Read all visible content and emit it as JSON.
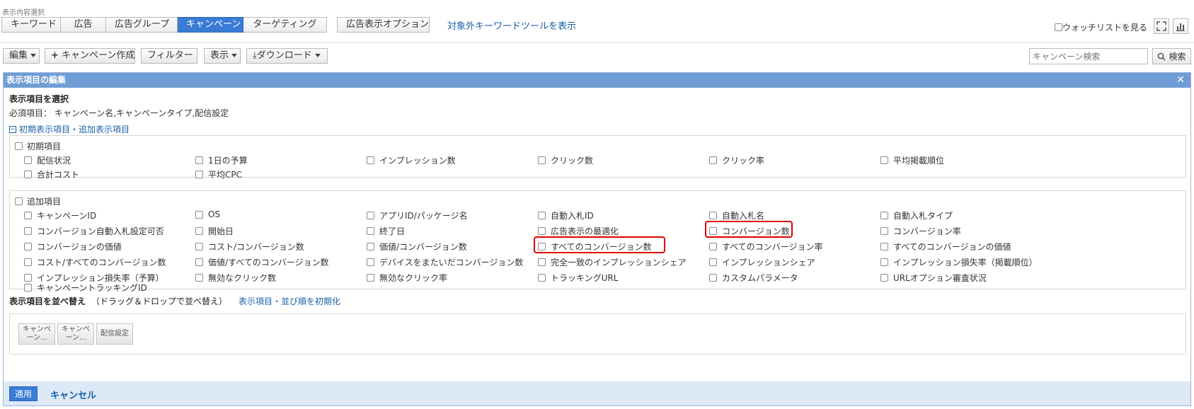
{
  "header": {
    "select_caption": "表示内容選択",
    "tabs": [
      "キーワード",
      "広告",
      "広告グループ",
      "キャンペーン",
      "ターゲティング"
    ],
    "active_tab": "キャンペーン",
    "option_tab": "広告表示オプション",
    "kw_tool_link": "対象外キーワードツールを表示",
    "watchlist_label": "ウォッチリストを見る"
  },
  "toolbar": {
    "edit": "編集",
    "create": "キャンペーン作成",
    "filter": "フィルター",
    "display": "表示",
    "download": "ダウンロード",
    "search_placeholder": "キャンペーン検索",
    "search_button": "検索"
  },
  "panel": {
    "title": "表示項目の編集",
    "select_title": "表示項目を選択",
    "required": "必須項目： キャンペーン名,キャンペーンタイプ,配信設定",
    "toggle_link": "初期表示項目・追加表示項目",
    "initial": {
      "title": "初期項目",
      "items": [
        "配信状況",
        "1日の予算",
        "インプレッション数",
        "クリック数",
        "クリック率",
        "平均掲載順位",
        "合計コスト",
        "平均CPC"
      ]
    },
    "additional": {
      "title": "追加項目",
      "items": [
        "キャンペーンID",
        "OS",
        "アプリID/パッケージ名",
        "自動入札ID",
        "自動入札名",
        "自動入札タイプ",
        "コンバージョン自動入札設定可否",
        "開始日",
        "終了日",
        "広告表示の最適化",
        "コンバージョン数",
        "コンバージョン率",
        "コンバージョンの価値",
        "コスト/コンバージョン数",
        "価値/コンバージョン数",
        "すべてのコンバージョン数",
        "すべてのコンバージョン率",
        "すべてのコンバージョンの価値",
        "コスト/すべてのコンバージョン数",
        "価値/すべてのコンバージョン数",
        "デバイスをまたいだコンバージョン数",
        "完全一致のインプレッションシェア",
        "インプレッションシェア",
        "インプレッション損失率（掲載順位）",
        "インプレッション損失率（予算）",
        "無効なクリック数",
        "無効なクリック率",
        "トラッキングURL",
        "カスタムパラメータ",
        "URLオプション審査状況",
        "キャンペーントラッキングID"
      ]
    },
    "sort": {
      "title": "表示項目を並べ替え",
      "hint": "（ドラッグ＆ドロップで並べ替え）",
      "reset_link": "表示項目・並び順を初期化",
      "chips": [
        "キャンペ\nーン...",
        "キャンペ\nーン...",
        "配信設定"
      ]
    },
    "apply": "適用",
    "cancel": "キャンセル"
  }
}
